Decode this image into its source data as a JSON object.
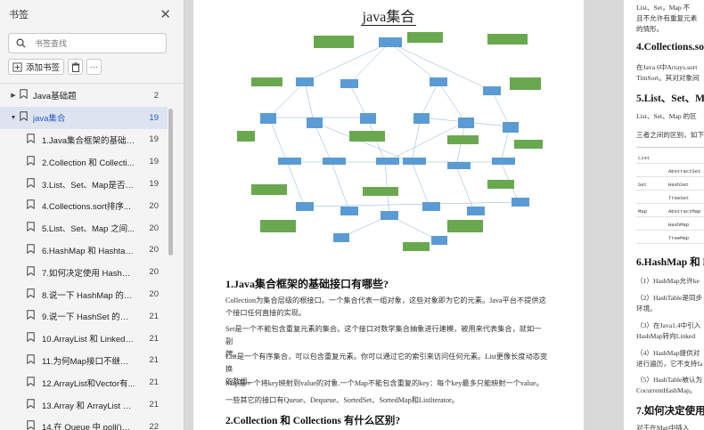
{
  "sidebar": {
    "title": "书签",
    "search_placeholder": "书签查找",
    "add_bookmark_label": "添加书签",
    "items": [
      {
        "label": "Java基础题",
        "page": "2",
        "level": 0,
        "expanded": false,
        "selected": false
      },
      {
        "label": "java集合",
        "page": "19",
        "level": 0,
        "expanded": true,
        "selected": true
      },
      {
        "label": "1.Java集合框架的基础接...",
        "page": "19",
        "level": 1
      },
      {
        "label": "2.Collection 和 Collecti...",
        "page": "19",
        "level": 1
      },
      {
        "label": "3.List、Set、Map是否继...",
        "page": "19",
        "level": 1
      },
      {
        "label": "4.Collections.sort排序...",
        "page": "20",
        "level": 1
      },
      {
        "label": "5.List、Set、Map 之间...",
        "page": "20",
        "level": 1
      },
      {
        "label": "6.HashMap 和 Hashtabl...",
        "page": "20",
        "level": 1
      },
      {
        "label": "7.如何决定使用 HashMa...",
        "page": "20",
        "level": 1
      },
      {
        "label": "8.说一下 HashMap 的实...",
        "page": "20",
        "level": 1
      },
      {
        "label": "9.说一下 HashSet 的实...",
        "page": "21",
        "level": 1
      },
      {
        "label": "10.ArrayList 和 LinkedLi...",
        "page": "21",
        "level": 1
      },
      {
        "label": "11.为何Map接口不继承C...",
        "page": "21",
        "level": 1
      },
      {
        "label": "12.ArrayList和Vector有...",
        "page": "21",
        "level": 1
      },
      {
        "label": "13.Array 和 ArrayList 有...",
        "page": "21",
        "level": 1
      },
      {
        "label": "14.在 Queue 中 poll()和...",
        "page": "22",
        "level": 1
      }
    ]
  },
  "main_page": {
    "title": "java集合",
    "h1": "1.Java集合框架的基础接口有哪些?",
    "p1a": "Collection为集合层级的根接口。一个集合代表一组对象，这些对象即为它的元素。Java平台不提供这",
    "p1b": "个接口任何直接的实现。",
    "p2a": "Set是一个不能包含重复元素的集合。这个接口对数学集合抽象进行建模，被用来代表集合，就如一副",
    "p2b": "牌。",
    "p3a": "List是一个有序集合，可以包含重复元素。你可以通过它的索引来访问任何元素。List更像长度动态变换",
    "p3b": "的数组。",
    "p4": "Map是一个将key映射到value的对象.一个Map不能包含重复的key：每个key最多只能映射一个value。",
    "p5": "一些其它的接口有Queue、Dequeue、SortedSet、SortedMap和ListIterator。",
    "h2": "2.Collection 和 Collections 有什么区别?"
  },
  "right_page": {
    "t1": "List、Set，Map 不",
    "t2": "且不允许有重复元素",
    "t3": "的情形。",
    "h4": "4.Collections.so",
    "t4a": "在Java 6中Arrays.sort",
    "t4b": "TimSort。其对对象间",
    "h5": "5.List、Set、M",
    "t5": "List、Set、Map 的区",
    "t6": "三者之间的区别，如下",
    "table_rows": [
      [
        "List",
        ""
      ],
      [
        "",
        "AbstractSet"
      ],
      [
        "Set",
        "HashSet"
      ],
      [
        "",
        "TreeSet"
      ],
      [
        "Map",
        "AbstractMap"
      ],
      [
        "",
        "HashMap"
      ],
      [
        "",
        "TreeMap"
      ]
    ],
    "h6": "6.HashMap 和 H",
    "t7": "（1）HashMap允许ke",
    "t8": "（2）HashTable是同步",
    "t8b": "环境。",
    "t9": "（3）在Java1.4中引入",
    "t9b": "HashMap转向Linked",
    "t10": "（4）HashMap提供对",
    "t10b": "进行遍历，它不支持fa",
    "t11": "（5）HashTable被认为",
    "t11b": "CocurrentHashMap。",
    "h7": "7.如何决定使用",
    "t12": "对于在Map中插入"
  },
  "colors": {
    "selected_bg": "#dde4f0",
    "selected_text": "#2b57c9",
    "diagram_blue": "#5b9bd5",
    "diagram_green": "#6aa84f"
  }
}
